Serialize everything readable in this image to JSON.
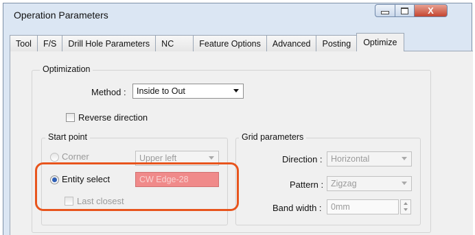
{
  "window": {
    "title": "Operation Parameters",
    "close_glyph": "X"
  },
  "tabs": [
    {
      "label": "Tool"
    },
    {
      "label": "F/S"
    },
    {
      "label": "Drill Hole Parameters"
    },
    {
      "label": "NC"
    },
    {
      "label": "Feature Options"
    },
    {
      "label": "Advanced"
    },
    {
      "label": "Posting"
    },
    {
      "label": "Optimize"
    }
  ],
  "active_tab": "Optimize",
  "optimization": {
    "legend": "Optimization",
    "method_label": "Method :",
    "method_value": "Inside to Out",
    "reverse_label": "Reverse direction",
    "reverse_checked": false
  },
  "start_point": {
    "legend": "Start point",
    "corner_label": "Corner",
    "corner_value": "Upper left",
    "entity_label": "Entity select",
    "entity_value": "CW Edge-28",
    "entity_selected": true,
    "last_closest_label": "Last closest"
  },
  "grid": {
    "legend": "Grid parameters",
    "direction_label": "Direction :",
    "direction_value": "Horizontal",
    "pattern_label": "Pattern :",
    "pattern_value": "Zigzag",
    "band_label": "Band width :",
    "band_value": "0mm"
  },
  "colors": {
    "highlight": "#e8541c",
    "entity_field_bg": "#f08a8a"
  }
}
